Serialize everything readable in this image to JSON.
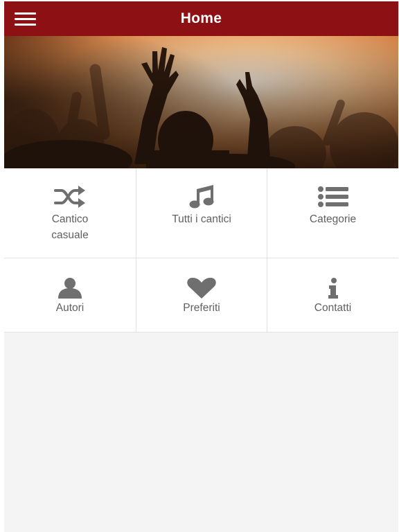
{
  "header": {
    "title": "Home",
    "menu_icon": "hamburger-menu-icon",
    "background_color": "#8c1014"
  },
  "hero": {
    "image": "concert-crowd-raised-hands-photo",
    "tint": "#e8a46a"
  },
  "tiles": [
    {
      "label_line1": "Cantico",
      "label_line2": "casuale",
      "icon": "shuffle-icon"
    },
    {
      "label_line1": "Tutti i cantici",
      "label_line2": "",
      "icon": "music-note-icon"
    },
    {
      "label_line1": "Categorie",
      "label_line2": "",
      "icon": "list-icon"
    },
    {
      "label_line1": "Autori",
      "label_line2": "",
      "icon": "user-icon"
    },
    {
      "label_line1": "Preferiti",
      "label_line2": "",
      "icon": "heart-icon"
    },
    {
      "label_line1": "Contatti",
      "label_line2": "",
      "icon": "info-icon"
    }
  ],
  "colors": {
    "icon": "#6f6f6f",
    "label": "#5f5f5f",
    "page_background": "#f4f4f4"
  }
}
